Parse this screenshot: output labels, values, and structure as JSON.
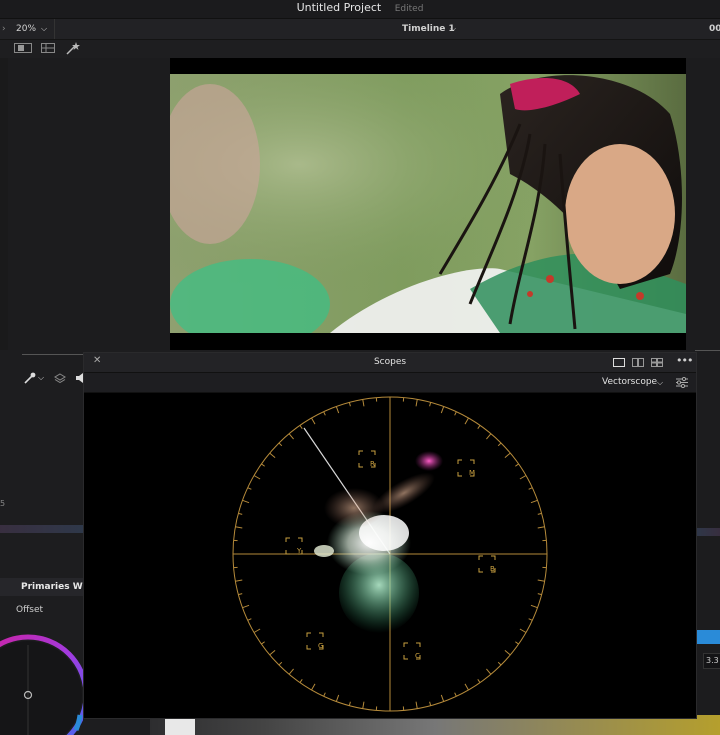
{
  "app": {
    "project_title": "Untitled Project",
    "project_status": "Edited"
  },
  "viewer_bar": {
    "zoom": "20%",
    "timeline": "Timeline 1",
    "timecode_right": "00"
  },
  "scopes": {
    "title": "Scopes",
    "mode": "Vectorscope",
    "targets": [
      "R",
      "M",
      "B",
      "C",
      "G",
      "Y"
    ]
  },
  "left_panel": {
    "primaries_label": "Primaries Whe",
    "offset_label": "Offset",
    "marker_left": "5"
  },
  "right_panel": {
    "value": "3.3"
  },
  "colors": {
    "graticule": "#b58a3a",
    "accent": "#2a8bd8"
  },
  "icons": {
    "close": "close-icon",
    "scope_layout_1": "single-view-icon",
    "scope_layout_2": "dual-view-icon",
    "scope_layout_4": "quad-view-icon",
    "more": "more-icon",
    "settings": "scope-settings-icon",
    "eyedropper": "eyedropper-icon",
    "magic": "magic-wand-icon"
  }
}
